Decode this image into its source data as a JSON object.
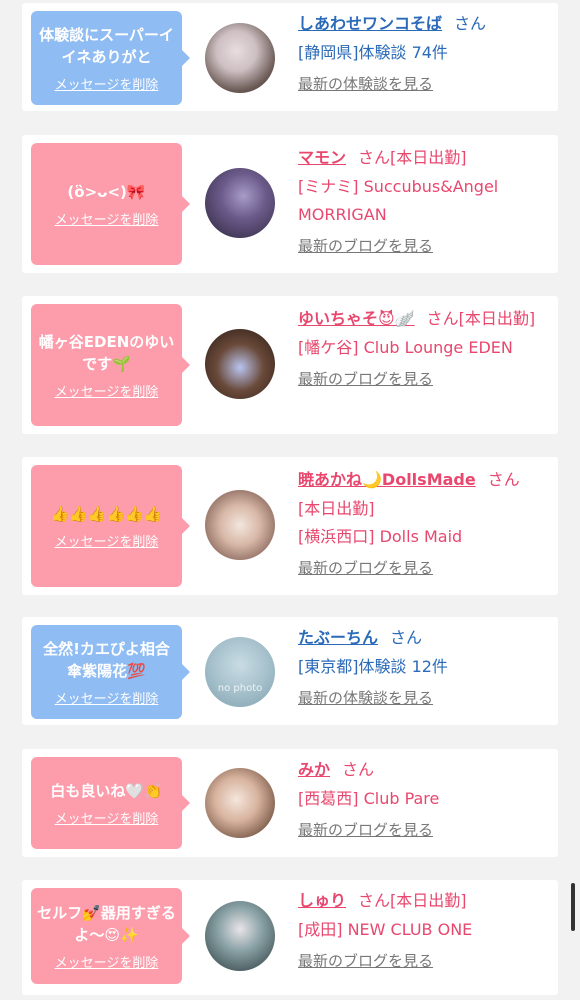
{
  "items": [
    {
      "type": "blue",
      "message": "体験談にスーパーイイネありがと",
      "delete": "メッセージを削除",
      "name": "しあわせワンコそば",
      "suffix": "さん",
      "sub": "[静岡県]体験談 74件",
      "see_more": "最新の体験談を見る",
      "avatar": "cherry-blossom-photo"
    },
    {
      "type": "pink",
      "message": "(ὃ>ᴗ<)🎀",
      "delete": "メッセージを削除",
      "name": "マモン",
      "suffix": "さん[本日出勤]",
      "sub": "[ミナミ] Succubus&Angel MORRIGAN",
      "see_more": "最新のブログを見る",
      "avatar": "girl-photo"
    },
    {
      "type": "pink",
      "message": "幡ヶ谷EDENのゆいです🌱",
      "delete": "メッセージを削除",
      "name": "ゆいちゃそ😈🪽",
      "suffix": "さん[本日出勤]",
      "sub": "[幡ケ谷] Club Lounge EDEN",
      "see_more": "最新のブログを見る",
      "avatar": "flower-photo"
    },
    {
      "type": "pink",
      "message": "👍👍👍👍👍👍",
      "delete": "メッセージを削除",
      "name": "暁あかね🌙DollsMade",
      "suffix": "さん",
      "sub": "[本日出勤]",
      "sub2": "[横浜西口] Dolls Maid",
      "see_more": "最新のブログを見る",
      "avatar": "maid-photo"
    },
    {
      "type": "blue",
      "message": "全然!カエぴよ相合傘紫陽花💯",
      "delete": "メッセージを削除",
      "name": "たぶーちん",
      "suffix": "さん",
      "sub": "[東京都]体験談 12件",
      "see_more": "最新の体験談を見る",
      "avatar": "no-photo",
      "avatar_label": "no photo"
    },
    {
      "type": "pink",
      "message": "白も良いね🤍👏",
      "delete": "メッセージを削除",
      "name": "みか",
      "suffix": "さん",
      "sub": "[西葛西] Club Pare",
      "see_more": "最新のブログを見る",
      "avatar": "portrait-photo"
    },
    {
      "type": "pink",
      "message": "セルフ💅器用すぎるよ〜😍✨",
      "delete": "メッセージを削除",
      "name": "しゅり",
      "suffix": "さん[本日出勤]",
      "sub": "[成田] NEW CLUB ONE",
      "see_more": "最新のブログを見る",
      "avatar": "selfie-photo"
    }
  ],
  "colors": {
    "pink": "#fd9cab",
    "blue": "#8fbcf2",
    "name_pink": "#e8476e",
    "name_blue": "#2a6ab8"
  }
}
